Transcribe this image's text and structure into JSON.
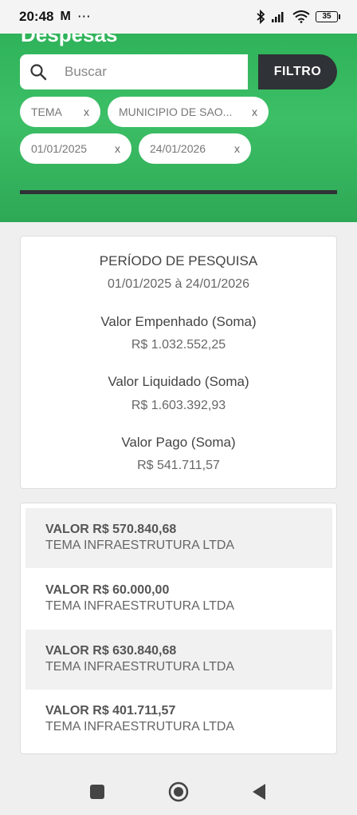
{
  "status_bar": {
    "time": "20:48",
    "app_icon": "M",
    "more": "⋯",
    "battery": "35"
  },
  "header": {
    "title": "Despesas",
    "search": {
      "placeholder": "Buscar",
      "value": ""
    },
    "filter_button": "FILTRO",
    "chips": [
      {
        "label": "TEMA",
        "close": "x"
      },
      {
        "label": "MUNICIPIO DE SAO...",
        "close": "x"
      },
      {
        "label": "01/01/2025",
        "close": "x"
      },
      {
        "label": "24/01/2026",
        "close": "x"
      }
    ],
    "accent_color": "#35b860"
  },
  "summary": {
    "period_label": "PERÍODO DE PESQUISA",
    "period_value": "01/01/2025 à 24/01/2026",
    "empenhado_label": "Valor Empenhado (Soma)",
    "empenhado_value": "R$ 1.032.552,25",
    "liquidado_label": "Valor Liquidado (Soma)",
    "liquidado_value": "R$ 1.603.392,93",
    "pago_label": "Valor Pago (Soma)",
    "pago_value": "R$ 541.711,57"
  },
  "results": [
    {
      "value": "VALOR R$ 570.840,68",
      "name": "TEMA INFRAESTRUTURA LTDA"
    },
    {
      "value": "VALOR R$ 60.000,00",
      "name": "TEMA INFRAESTRUTURA LTDA"
    },
    {
      "value": "VALOR R$ 630.840,68",
      "name": "TEMA INFRAESTRUTURA LTDA"
    },
    {
      "value": "VALOR R$ 401.711,57",
      "name": "TEMA INFRAESTRUTURA LTDA"
    }
  ],
  "nav": {
    "recents_icon": "square-icon",
    "home_icon": "circle-icon",
    "back_icon": "triangle-back-icon"
  }
}
